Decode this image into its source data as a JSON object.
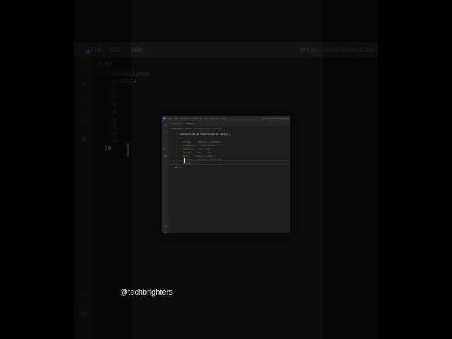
{
  "background": {
    "menu": [
      "File",
      "Edit",
      "Sele"
    ],
    "window_title": "ers.js - Visual Studio Code",
    "breadcrumb": "› ) Techbrighte",
    "doc_fragment": "docu",
    "tab_fragment": "© Ha",
    "line_numbers": [
      "1",
      "2",
      "3",
      "4",
      "5",
      "6",
      "7",
      "8",
      "9"
    ],
    "current_line": "10"
  },
  "watermark": "@techbrighters",
  "window": {
    "menu": [
      "File",
      "Edit",
      "Selection",
      "View",
      "Go",
      "Run",
      "Terminal",
      "Help"
    ],
    "title": "game.js - Visual Studio Code",
    "tabs": [
      {
        "label": "Game.html",
        "active": false
      },
      {
        "label": "JS game.js",
        "active": true
      }
    ],
    "breadcrumbs": "› Techbrighters › tutorials › javascript_tutorials › JS game.js",
    "code_lines": [
      {
        "n": "1",
        "text": "document.write(\"Techbrighters\".bold());"
      },
      {
        "n": "2",
        "text": "/*"
      },
      {
        "n": "3",
        "text": "  blink()   - <blink>...</blink>"
      },
      {
        "n": "4",
        "text": "  fontcolor() - <font color=\"...\">"
      },
      {
        "n": "5",
        "text": "  italics() - <i>...</i>"
      },
      {
        "n": "6",
        "text": "  fixed()  - <tt>...</tt>"
      },
      {
        "n": "7",
        "text": "  sup()   - <sup>...</sup>"
      },
      {
        "n": "8",
        "text": "  strike() - <strike>...</strike>"
      },
      {
        "n": "9",
        "text": "  string.  - ..."
      },
      {
        "n": "10",
        "text": "*/"
      }
    ]
  }
}
